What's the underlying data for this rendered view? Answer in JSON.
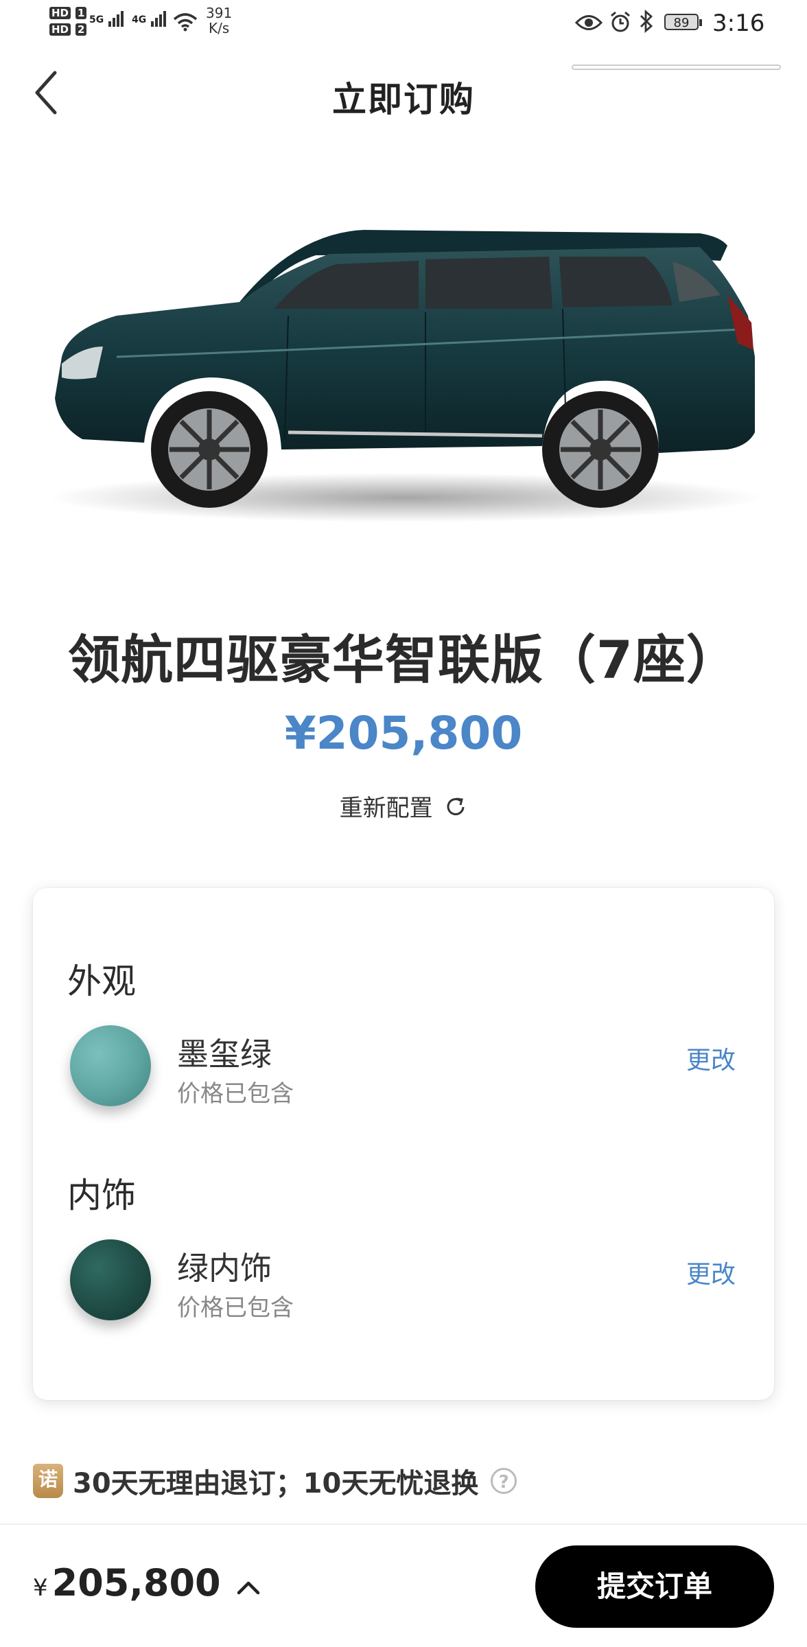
{
  "status_bar": {
    "hd1": "HD",
    "hd1_num": "1",
    "hd2": "HD",
    "hd2_num": "2",
    "sig1": "5G",
    "sig2": "4G",
    "net_speed": "391",
    "net_unit": "K/s",
    "battery": "89",
    "time": "3:16"
  },
  "header": {
    "title": "立即订购"
  },
  "car": {
    "image": "suv-dark-green-side-view",
    "model_name": "领航四驱豪华智联版（7座）",
    "price": "¥205,800",
    "reconfigure_label": "重新配置"
  },
  "config": {
    "exterior": {
      "section_title": "外观",
      "name": "墨玺绿",
      "included": "价格已包含",
      "change_label": "更改",
      "color": "#5ea5a2"
    },
    "interior": {
      "section_title": "内饰",
      "name": "绿内饰",
      "included": "价格已包含",
      "change_label": "更改",
      "color": "#1f4c45"
    }
  },
  "promise": {
    "badge": "诺",
    "text": "30天无理由退订；10天无忧退换",
    "help": "?"
  },
  "footer": {
    "currency": "¥",
    "total": "205,800",
    "submit_label": "提交订单"
  },
  "colors": {
    "accent": "#4a86c8",
    "button": "#000000"
  }
}
